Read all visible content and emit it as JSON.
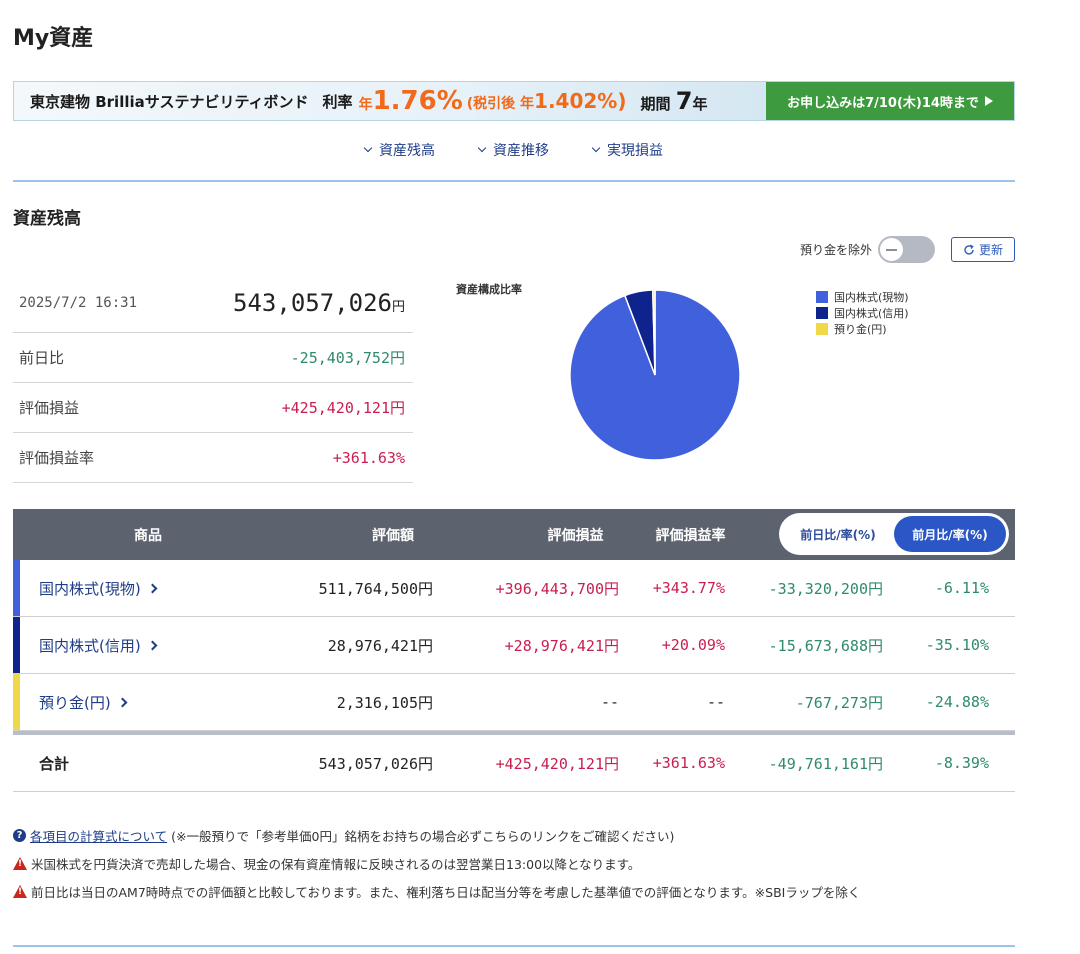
{
  "page": {
    "title": "My資産"
  },
  "banner": {
    "name": "東京建物 Brilliaサステナビリティボンド",
    "rate_label": "利率",
    "rate_prefix": "年",
    "rate_value": "1.76%",
    "aftertax_label": "(税引後",
    "aftertax_prefix": "年",
    "aftertax_value": "1.402%)",
    "period_label": "期間",
    "period_value": "7",
    "period_unit": "年",
    "cta": "お申し込みは7/10(木)14時まで"
  },
  "section_nav": [
    {
      "label": "資産残高"
    },
    {
      "label": "資産推移"
    },
    {
      "label": "実現損益"
    }
  ],
  "section": {
    "title": "資産残高"
  },
  "controls": {
    "exclude_cash_label": "預り金を除外",
    "exclude_cash_on": false,
    "refresh_label": "更新"
  },
  "summary": {
    "datetime": "2025/7/2 16:31",
    "total": "543,057,026",
    "total_unit": "円",
    "rows": [
      {
        "label": "前日比",
        "value": "-25,403,752円"
      },
      {
        "label": "評価損益",
        "value": "+425,420,121円"
      },
      {
        "label": "評価損益率",
        "value": "+361.63%"
      }
    ]
  },
  "chart_data": {
    "type": "pie",
    "title": "資産構成比率",
    "legend_position": "right",
    "slices": [
      {
        "label": "国内株式(現物)",
        "value": 511764500,
        "color": "#4160dc"
      },
      {
        "label": "国内株式(信用)",
        "value": 28976421,
        "color": "#0f238c"
      },
      {
        "label": "預り金(円)",
        "value": 2316105,
        "color": "#f0d84b"
      }
    ]
  },
  "table": {
    "headers": {
      "product": "商品",
      "valuation": "評価額",
      "pl": "評価損益",
      "pl_rate": "評価損益率"
    },
    "toggle": {
      "day_label": "前日比/率(%)",
      "month_label": "前月比/率(%)",
      "active": "month"
    },
    "rows": [
      {
        "product": "国内株式(現物)",
        "valuation": "511,764,500円",
        "pl": "+396,443,700円",
        "pl_rate": "+343.77%",
        "change": "-33,320,200円",
        "change_rate": "-6.11%",
        "color": "#4160dc"
      },
      {
        "product": "国内株式(信用)",
        "valuation": "28,976,421円",
        "pl": "+28,976,421円",
        "pl_rate": "+20.09%",
        "change": "-15,673,688円",
        "change_rate": "-35.10%",
        "color": "#0f238c"
      },
      {
        "product": "預り金(円)",
        "valuation": "2,316,105円",
        "pl": "--",
        "pl_rate": "--",
        "change": "-767,273円",
        "change_rate": "-24.88%",
        "color": "#f0d84b"
      }
    ],
    "total": {
      "product": "合計",
      "valuation": "543,057,026円",
      "pl": "+425,420,121円",
      "pl_rate": "+361.63%",
      "change": "-49,761,161円",
      "change_rate": "-8.39%"
    }
  },
  "notes": {
    "calc_link": "各項目の計算式について",
    "calc_text": "(※一般預りで「参考単価0円」銘柄をお持ちの場合必ずこちらのリンクをご確認ください)",
    "warn1": "米国株式を円貨決済で売却した場合、現金の保有資産情報に反映されるのは翌営業日13:00以降となります。",
    "warn2": "前日比は当日のAM7時時点での評価額と比較しております。また、権利落ち日は配当分等を考慮した基準値での評価となります。※SBIラップを除く"
  },
  "icons": {
    "play": "play-icon",
    "chevron": "chevron-down-icon",
    "refresh": "refresh-icon",
    "help": "question-icon",
    "warning": "warning-icon"
  }
}
